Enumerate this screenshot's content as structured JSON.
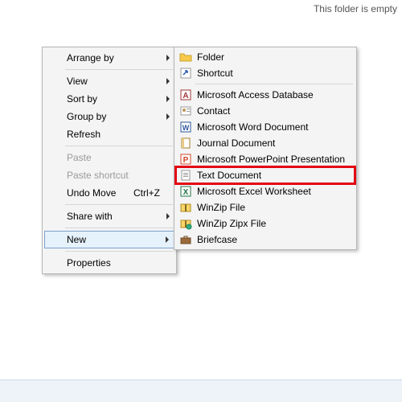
{
  "main": {
    "empty_text": "This folder is empty"
  },
  "context_menu": {
    "arrange_by": "Arrange by",
    "view": "View",
    "sort_by": "Sort by",
    "group_by": "Group by",
    "refresh": "Refresh",
    "paste": "Paste",
    "paste_shortcut": "Paste shortcut",
    "undo_move": "Undo Move",
    "undo_shortcut": "Ctrl+Z",
    "share_with": "Share with",
    "new": "New",
    "properties": "Properties"
  },
  "new_submenu": {
    "folder": "Folder",
    "shortcut": "Shortcut",
    "access_db": "Microsoft Access Database",
    "contact": "Contact",
    "word_doc": "Microsoft Word Document",
    "journal_doc": "Journal Document",
    "ppt": "Microsoft PowerPoint Presentation",
    "text_doc": "Text Document",
    "excel": "Microsoft Excel Worksheet",
    "winzip": "WinZip File",
    "winzipx": "WinZip Zipx File",
    "briefcase": "Briefcase"
  }
}
